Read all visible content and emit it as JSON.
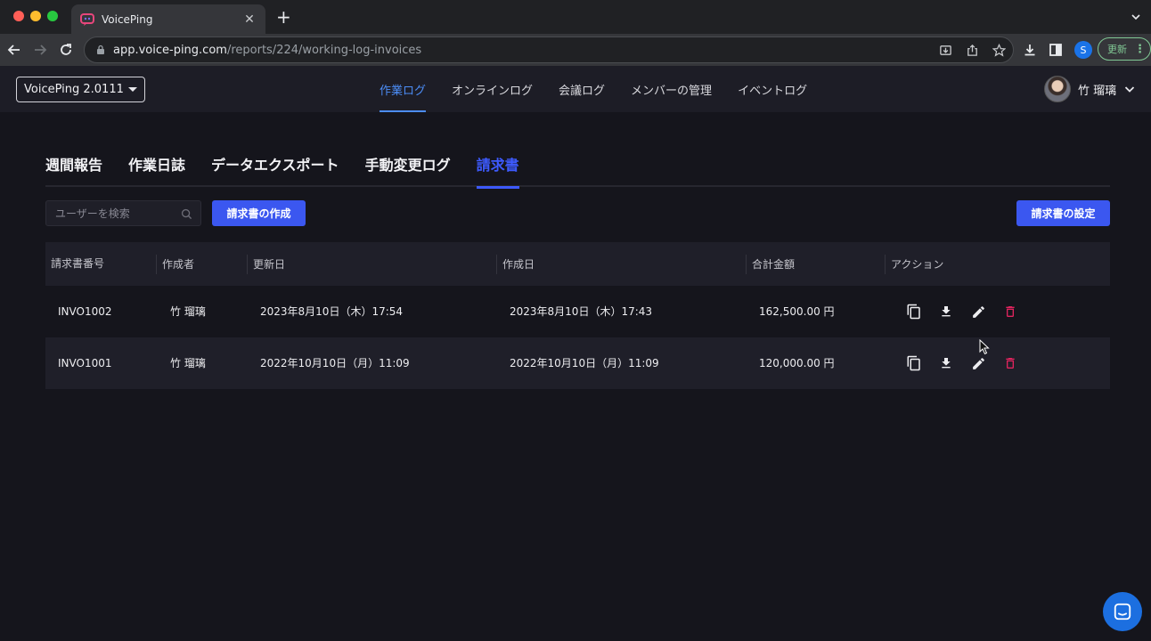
{
  "browser": {
    "tab_title": "VoicePing",
    "url_host": "app.voice-ping.com",
    "url_path": "/reports/224/working-log-invoices",
    "profile_initial": "S",
    "update_label": "更新"
  },
  "header": {
    "workspace": "VoicePing 2.0111",
    "nav": [
      {
        "label": "作業ログ",
        "active": true
      },
      {
        "label": "オンラインログ"
      },
      {
        "label": "会議ログ"
      },
      {
        "label": "メンバーの管理"
      },
      {
        "label": "イベントログ"
      }
    ],
    "user_name": "竹 瑠璃"
  },
  "subtabs": [
    {
      "label": "週間報告"
    },
    {
      "label": "作業日誌"
    },
    {
      "label": "データエクスポート"
    },
    {
      "label": "手動変更ログ"
    },
    {
      "label": "請求書",
      "active": true
    }
  ],
  "search": {
    "placeholder": "ユーザーを検索"
  },
  "buttons": {
    "create_invoice": "請求書の作成",
    "invoice_settings": "請求書の設定"
  },
  "table": {
    "headers": [
      "請求書番号",
      "作成者",
      "更新日",
      "作成日",
      "合計金額",
      "アクション"
    ],
    "rows": [
      {
        "number": "INVO1002",
        "author": "竹 瑠璃",
        "updated": "2023年8月10日（木）17:54",
        "created": "2023年8月10日（木）17:43",
        "total": "162,500.00 円"
      },
      {
        "number": "INVO1001",
        "author": "竹 瑠璃",
        "updated": "2022年10月10日（月）11:09",
        "created": "2022年10月10日（月）11:09",
        "total": "120,000.00 円"
      }
    ]
  },
  "colors": {
    "accent": "#3b57f0",
    "nav_active": "#4c8df6",
    "delete": "#e0245e",
    "background": "#15151c"
  },
  "icons": [
    "copy-icon",
    "download-icon",
    "edit-icon",
    "delete-icon",
    "search-icon",
    "chat-icon"
  ]
}
